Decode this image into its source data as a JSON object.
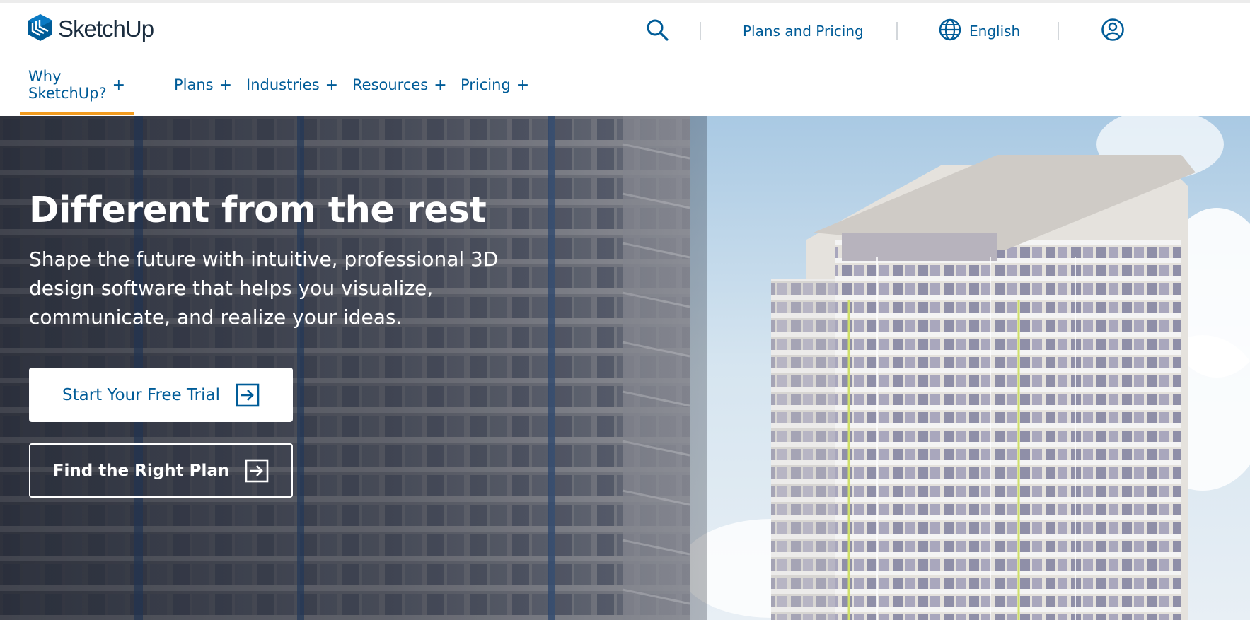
{
  "brand": {
    "name": "SketchUp",
    "logo_icon": "sketchup-cube-logo",
    "primary_color": "#005c98",
    "accent_color": "#f39c1f"
  },
  "utility_bar": {
    "search_icon": "search-icon",
    "plans_pricing_label": "Plans and Pricing",
    "language_icon": "globe-icon",
    "language_label": "English",
    "account_icon": "user-circle-icon"
  },
  "nav": {
    "items": [
      {
        "label": "Why SketchUp?",
        "active": true
      },
      {
        "label": "Plans",
        "active": false
      },
      {
        "label": "Industries",
        "active": false
      },
      {
        "label": "Resources",
        "active": false
      },
      {
        "label": "Pricing",
        "active": false
      }
    ],
    "expand_glyph": "+"
  },
  "hero": {
    "title": "Different from the rest",
    "subtitle": "Shape the future with intuitive, professional 3D design software that helps you visualize, communicate, and realize your ideas.",
    "primary_cta": {
      "label": "Start Your Free Trial",
      "icon": "arrow-right-box-icon"
    },
    "secondary_cta": {
      "label": "Find the Right Plan",
      "icon": "arrow-right-box-icon"
    }
  }
}
